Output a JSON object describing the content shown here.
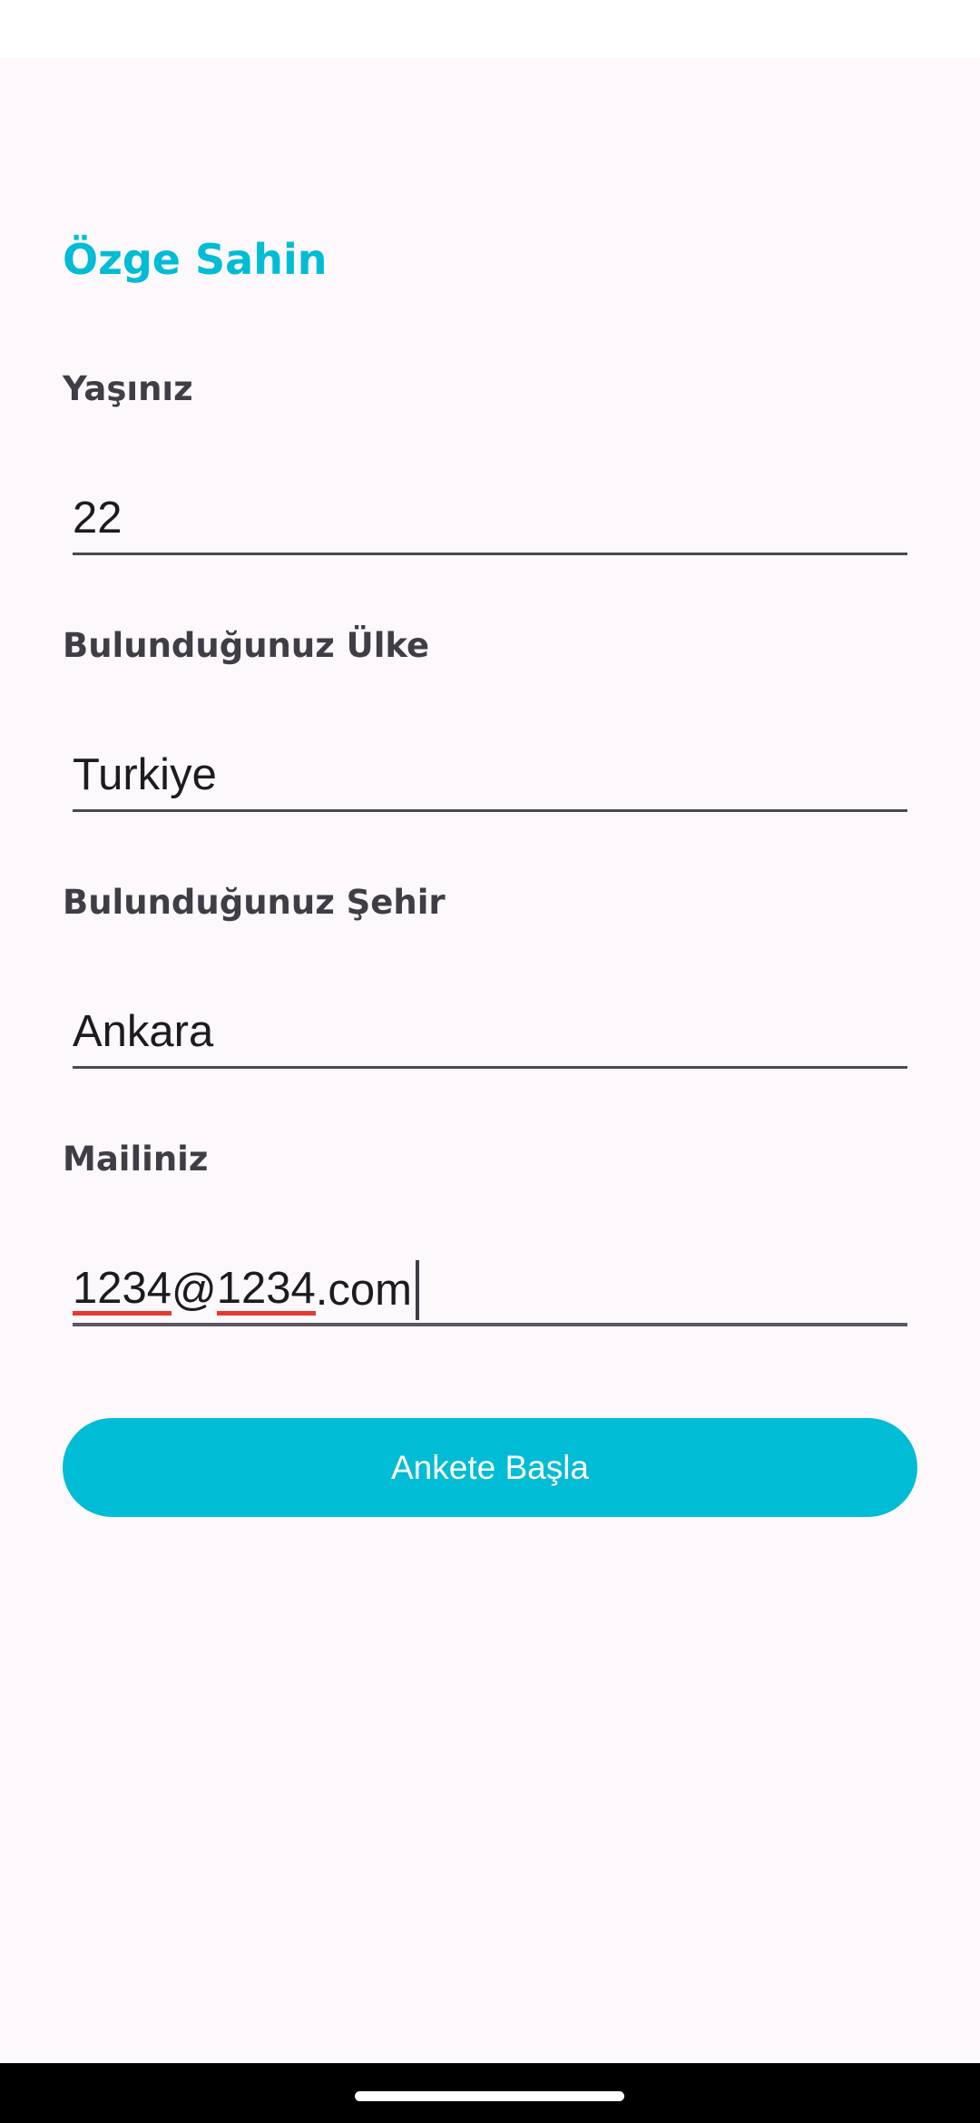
{
  "header": {
    "user_name": "Özge Sahin"
  },
  "form": {
    "age": {
      "label": "Yaşınız",
      "value": "22"
    },
    "country": {
      "label": "Bulunduğunuz Ülke",
      "value": "Turkiye"
    },
    "city": {
      "label": "Bulunduğunuz Şehir",
      "value": "Ankara"
    },
    "email": {
      "label": "Mailiniz",
      "value_part1": "1234",
      "value_part2": "@",
      "value_part3": "1234",
      "value_part4": ".com"
    }
  },
  "actions": {
    "start_label": "Ankete Başla"
  },
  "colors": {
    "accent": "#00bcd4",
    "background": "#fdf8fb",
    "label_text": "#3f3d46",
    "spellcheck_underline": "#e53935"
  }
}
